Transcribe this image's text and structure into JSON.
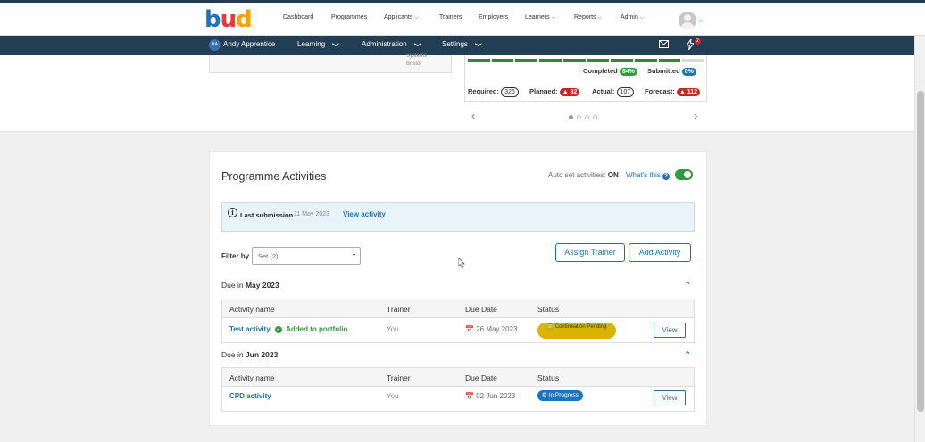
{
  "topnav": {
    "logo": "bud",
    "items": [
      {
        "label": "Dashboard"
      },
      {
        "label": "Programmes"
      },
      {
        "label": "Applicants"
      },
      {
        "label": "Trainers"
      },
      {
        "label": "Employers"
      },
      {
        "label": "Learners"
      },
      {
        "label": "Reports"
      },
      {
        "label": "Admin"
      }
    ]
  },
  "subnav": {
    "user_initials": "AA",
    "user_name": "Andy Apprentice",
    "items": [
      {
        "label": "Learning"
      },
      {
        "label": "Administration"
      },
      {
        "label": "Settings"
      }
    ],
    "notification_count": "2"
  },
  "org": {
    "line1": "Systems ,",
    "line2": "Bristol"
  },
  "progress": {
    "filled_segments": 9,
    "total_segments": 10,
    "completed_label": "Completed",
    "completed_value": "84%",
    "submitted_label": "Submitted",
    "submitted_value": "0%",
    "required_label": "Required:",
    "required_value": "326",
    "planned_label": "Planned:",
    "planned_value": "32",
    "actual_label": "Actual:",
    "actual_value": "107",
    "forecast_label": "Forecast:",
    "forecast_value": "112",
    "carousel_pages": 4,
    "carousel_active": 0
  },
  "activities": {
    "title": "Programme Activities",
    "autoset_label": "Auto set activities:",
    "autoset_state": "ON",
    "whats_this": "What's this",
    "last_submission_label": "Last submission",
    "last_submission_date": "11 May 2023",
    "view_activity": "View activity",
    "filter_label": "Filter by",
    "filter_value": "Set (2)",
    "assign_trainer": "Assign Trainer",
    "add_activity": "Add Activity",
    "col_name": "Activity name",
    "col_trainer": "Trainer",
    "col_due": "Due Date",
    "col_status": "Status",
    "view_label": "View",
    "groups": [
      {
        "prefix": "Due in",
        "month": "May 2023",
        "rows": [
          {
            "name": "Test activity",
            "badge": "Added to portfolio",
            "trainer": "You",
            "due": "26 May 2023",
            "status": "Confirmation Pending"
          }
        ]
      },
      {
        "prefix": "Due in",
        "month": "Jun 2023",
        "rows": [
          {
            "name": "CPD activity",
            "trainer": "You",
            "due": "02 Jun 2023",
            "status": "In Progress"
          }
        ]
      }
    ]
  },
  "colors": {
    "navy": "#233d55",
    "accent_blue": "#1e6fa8",
    "green": "#2e9d3a",
    "red": "#c62828",
    "warning_yellow": "#d9b400"
  }
}
